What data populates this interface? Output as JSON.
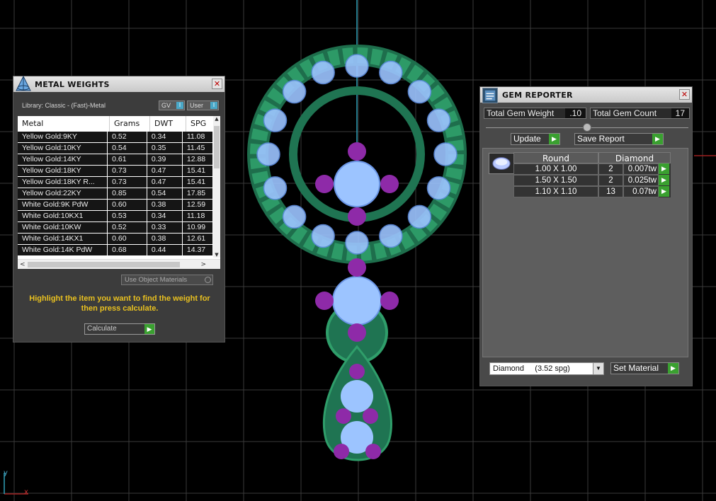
{
  "viewport": {
    "axis_y_label": "y",
    "axis_x_label": "x"
  },
  "metal_weights": {
    "title": "METAL WEIGHTS",
    "library_label": "Library: Classic - (Fast)-Metal",
    "gv_label": "GV",
    "user_label": "User",
    "columns": [
      "Metal",
      "Grams",
      "DWT",
      "SPG"
    ],
    "rows": [
      [
        "Yellow Gold:9KY",
        "0.52",
        "0.34",
        "11.08"
      ],
      [
        "Yellow Gold:10KY",
        "0.54",
        "0.35",
        "11.45"
      ],
      [
        "Yellow Gold:14KY",
        "0.61",
        "0.39",
        "12.88"
      ],
      [
        "Yellow Gold:18KY",
        "0.73",
        "0.47",
        "15.41"
      ],
      [
        "Yellow Gold:18KY R...",
        "0.73",
        "0.47",
        "15.41"
      ],
      [
        "Yellow Gold:22KY",
        "0.85",
        "0.54",
        "17.85"
      ],
      [
        "White Gold:9K PdW",
        "0.60",
        "0.38",
        "12.59"
      ],
      [
        "White Gold:10KX1",
        "0.53",
        "0.34",
        "11.18"
      ],
      [
        "White Gold:10KW",
        "0.52",
        "0.33",
        "10.99"
      ],
      [
        "White Gold:14KX1",
        "0.60",
        "0.38",
        "12.61"
      ],
      [
        "White Gold:14K PdW",
        "0.68",
        "0.44",
        "14.37"
      ]
    ],
    "use_object_materials": "Use Object Materials",
    "instruction": "Highlight the item you want to find the weight for then press calculate.",
    "calculate_label": "Calculate"
  },
  "gem_reporter": {
    "title": "GEM REPORTER",
    "total_weight_label": "Total Gem Weight",
    "total_weight_value": ".10",
    "total_count_label": "Total Gem Count",
    "total_count_value": "17",
    "update_label": "Update",
    "save_report_label": "Save Report",
    "header_shape": "Round",
    "header_material": "Diamond",
    "rows": [
      {
        "size": "1.00 X 1.00",
        "count": "2",
        "weight": "0.007tw"
      },
      {
        "size": "1.50 X 1.50",
        "count": "2",
        "weight": "0.025tw"
      },
      {
        "size": "1.10 X 1.10",
        "count": "13",
        "weight": "0.07tw"
      }
    ],
    "material_select": "Diamond     (3.52 spg)",
    "set_material_label": "Set Material"
  },
  "colors": {
    "metal": "#2f9e6a",
    "gem_blue": "#9cc4ff",
    "gem_purple": "#8e2aa8",
    "accent_go": "#3aa030",
    "instruction_text": "#e8c020"
  }
}
